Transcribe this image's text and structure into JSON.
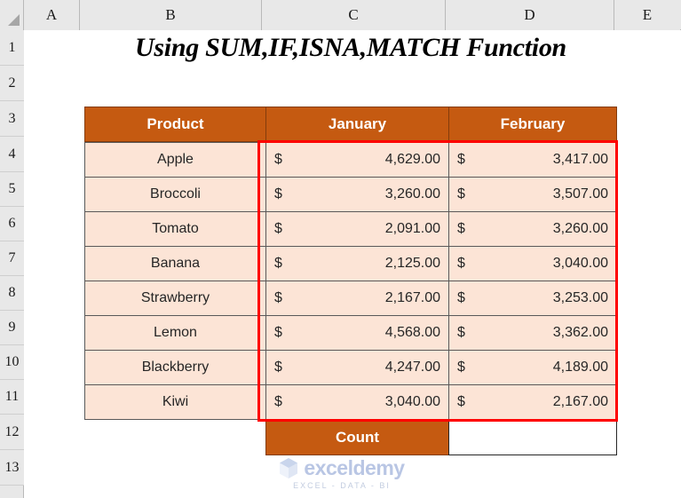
{
  "app": {
    "type": "spreadsheet",
    "select_all_icon": "select-all-triangle-icon"
  },
  "grid": {
    "column_headers": [
      "A",
      "B",
      "C",
      "D",
      "E"
    ],
    "row_headers": [
      "1",
      "2",
      "3",
      "4",
      "5",
      "6",
      "7",
      "8",
      "9",
      "10",
      "11",
      "12",
      "13"
    ]
  },
  "title": "Using SUM,IF,ISNA,MATCH Function",
  "table": {
    "headers": [
      "Product",
      "January",
      "February"
    ],
    "rows": [
      {
        "product": "Apple",
        "jan_symbol": "$",
        "jan": "4,629.00",
        "feb_symbol": "$",
        "feb": "3,417.00"
      },
      {
        "product": "Broccoli",
        "jan_symbol": "$",
        "jan": "3,260.00",
        "feb_symbol": "$",
        "feb": "3,507.00"
      },
      {
        "product": "Tomato",
        "jan_symbol": "$",
        "jan": "2,091.00",
        "feb_symbol": "$",
        "feb": "3,260.00"
      },
      {
        "product": "Banana",
        "jan_symbol": "$",
        "jan": "2,125.00",
        "feb_symbol": "$",
        "feb": "3,040.00"
      },
      {
        "product": "Strawberry",
        "jan_symbol": "$",
        "jan": "2,167.00",
        "feb_symbol": "$",
        "feb": "3,253.00"
      },
      {
        "product": "Lemon",
        "jan_symbol": "$",
        "jan": "4,568.00",
        "feb_symbol": "$",
        "feb": "3,362.00"
      },
      {
        "product": "Blackberry",
        "jan_symbol": "$",
        "jan": "4,247.00",
        "feb_symbol": "$",
        "feb": "4,189.00"
      },
      {
        "product": "Kiwi",
        "jan_symbol": "$",
        "jan": "3,040.00",
        "feb_symbol": "$",
        "feb": "2,167.00"
      }
    ],
    "count_label": "Count",
    "count_value": ""
  },
  "annotation": {
    "highlight_color": "#FF0000",
    "highlight_description": "red-rectangle-around-january-february-values"
  },
  "watermark": {
    "brand": "exceldemy",
    "tagline": "EXCEL - DATA - BI",
    "color": "#b9c6e4"
  },
  "colors": {
    "header_fill": "#C55A11",
    "data_fill": "#FCE4D6",
    "grid_header_fill": "#E8E8E8",
    "border": "#595959"
  }
}
